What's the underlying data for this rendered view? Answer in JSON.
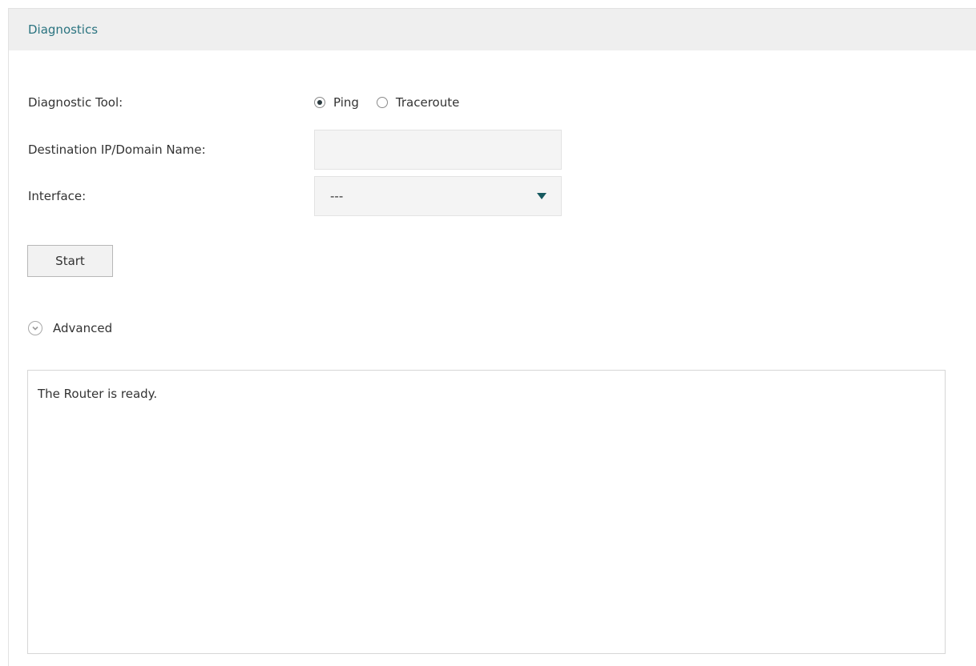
{
  "panel": {
    "title": "Diagnostics"
  },
  "form": {
    "tool_label": "Diagnostic Tool:",
    "tool_options": [
      {
        "label": "Ping",
        "selected": true
      },
      {
        "label": "Traceroute",
        "selected": false
      }
    ],
    "destination_label": "Destination IP/Domain Name:",
    "destination_value": "",
    "interface_label": "Interface:",
    "interface_value": "---",
    "start_label": "Start",
    "advanced_label": "Advanced"
  },
  "output": {
    "text": "The Router is ready."
  },
  "colors": {
    "accent": "#2b7480",
    "arrow": "#16595f",
    "header_bg": "#efefef",
    "input_bg": "#f4f4f4"
  },
  "icons": {
    "select_arrow": "caret-down-icon",
    "advanced": "chevron-circle-down-icon"
  }
}
